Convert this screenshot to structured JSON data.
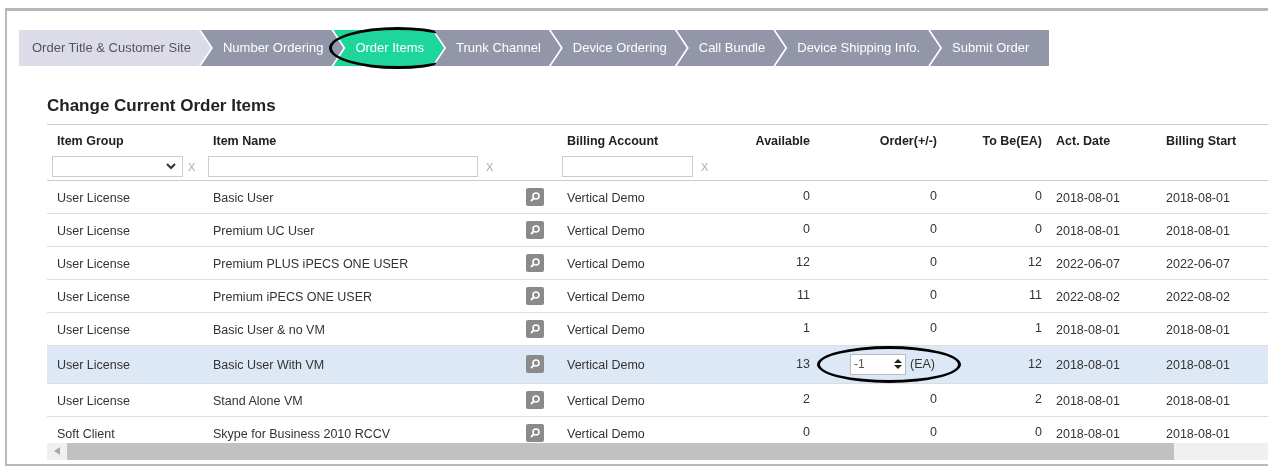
{
  "steps": [
    {
      "label": "Order Title & Customer Site",
      "done": true,
      "selected": false,
      "circled": false
    },
    {
      "label": "Number Ordering",
      "done": false,
      "selected": false,
      "circled": false
    },
    {
      "label": "Order Items",
      "done": false,
      "selected": true,
      "circled": true
    },
    {
      "label": "Trunk Channel",
      "done": false,
      "selected": false,
      "circled": false
    },
    {
      "label": "Device Ordering",
      "done": false,
      "selected": false,
      "circled": false
    },
    {
      "label": "Call Bundle",
      "done": false,
      "selected": false,
      "circled": false
    },
    {
      "label": "Device Shipping Info.",
      "done": false,
      "selected": false,
      "circled": false
    },
    {
      "label": "Submit Order",
      "done": false,
      "selected": false,
      "circled": false
    }
  ],
  "section_title": "Change Current Order Items",
  "table": {
    "columns": [
      "Item Group",
      "Item Name",
      "Billing Account",
      "Available",
      "Order(+/-)",
      "To Be(EA)",
      "Act. Date",
      "Billing Start"
    ],
    "filters": {
      "clear_marks": [
        "X",
        "X",
        "X"
      ]
    },
    "rows": [
      {
        "group": "User License",
        "name": "Basic User",
        "billing": "Vertical Demo",
        "available": "0",
        "order": "0",
        "to_be": "0",
        "act_date": "2018-08-01",
        "billing_start": "2018-08-01",
        "selected": false
      },
      {
        "group": "User License",
        "name": "Premium UC User",
        "billing": "Vertical Demo",
        "available": "0",
        "order": "0",
        "to_be": "0",
        "act_date": "2018-08-01",
        "billing_start": "2018-08-01",
        "selected": false
      },
      {
        "group": "User License",
        "name": "Premium PLUS iPECS ONE USER",
        "billing": "Vertical Demo",
        "available": "12",
        "order": "0",
        "to_be": "12",
        "act_date": "2022-06-07",
        "billing_start": "2022-06-07",
        "selected": false
      },
      {
        "group": "User License",
        "name": "Premium iPECS ONE USER",
        "billing": "Vertical Demo",
        "available": "11",
        "order": "0",
        "to_be": "11",
        "act_date": "2022-08-02",
        "billing_start": "2022-08-02",
        "selected": false
      },
      {
        "group": "User License",
        "name": "Basic User & no VM",
        "billing": "Vertical Demo",
        "available": "1",
        "order": "0",
        "to_be": "1",
        "act_date": "2018-08-01",
        "billing_start": "2018-08-01",
        "selected": false
      },
      {
        "group": "User License",
        "name": "Basic User With VM",
        "billing": "Vertical Demo",
        "available": "13",
        "order_input": {
          "value": "-1",
          "unit": "(EA)",
          "circled": true
        },
        "to_be": "12",
        "act_date": "2018-08-01",
        "billing_start": "2018-08-01",
        "selected": true
      },
      {
        "group": "User License",
        "name": "Stand Alone VM",
        "billing": "Vertical Demo",
        "available": "2",
        "order": "0",
        "to_be": "2",
        "act_date": "2018-08-01",
        "billing_start": "2018-08-01",
        "selected": false
      },
      {
        "group": "Soft Client",
        "name": "Skype for Business 2010 RCCV",
        "billing": "Vertical Demo",
        "available": "0",
        "order": "0",
        "to_be": "0",
        "act_date": "2018-08-01",
        "billing_start": "2018-08-01",
        "selected": false
      }
    ]
  }
}
